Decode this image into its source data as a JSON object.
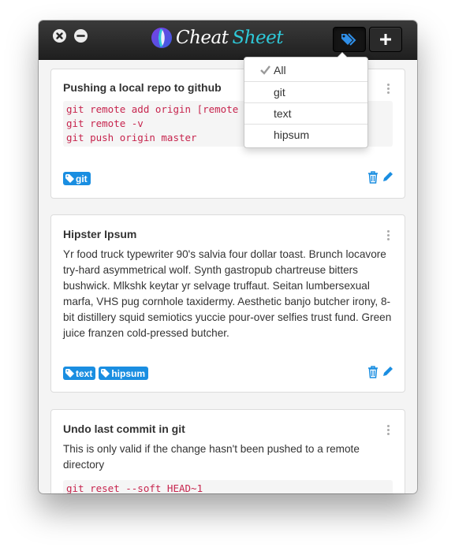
{
  "app": {
    "title_part1": "Cheat",
    "title_part2": "Sheet"
  },
  "toolbar": {
    "tags_icon": "tags-icon",
    "add_icon": "plus-icon"
  },
  "tag_filter": {
    "selected": "All",
    "options": [
      "All",
      "git",
      "text",
      "hipsum"
    ]
  },
  "cards": [
    {
      "title": "Pushing a local repo to github",
      "code_lines": [
        "git remote add origin [remote",
        "git remote -v",
        "git push origin master"
      ],
      "tags": [
        "git"
      ]
    },
    {
      "title": "Hipster Ipsum",
      "text": "Yr food truck typewriter 90's salvia four dollar toast. Brunch locavore try-hard asymmetrical wolf. Synth gastropub chartreuse bitters bushwick. Mlkshk keytar yr selvage truffaut. Seitan lumbersexual marfa, VHS pug cornhole taxidermy. Aesthetic banjo butcher irony, 8-bit distillery squid semiotics yuccie pour-over selfies trust fund. Green juice franzen cold-pressed butcher.",
      "tags": [
        "text",
        "hipsum"
      ]
    },
    {
      "title": "Undo last commit in git",
      "text": "This is only valid if the change hasn't been pushed to a remote directory",
      "code_lines": [
        "git reset --soft HEAD~1"
      ]
    }
  ],
  "colors": {
    "accent": "#1a8ee1",
    "code": "#c7254e",
    "titlebar": "#262626",
    "logo_accent": "#2ec9d9"
  }
}
